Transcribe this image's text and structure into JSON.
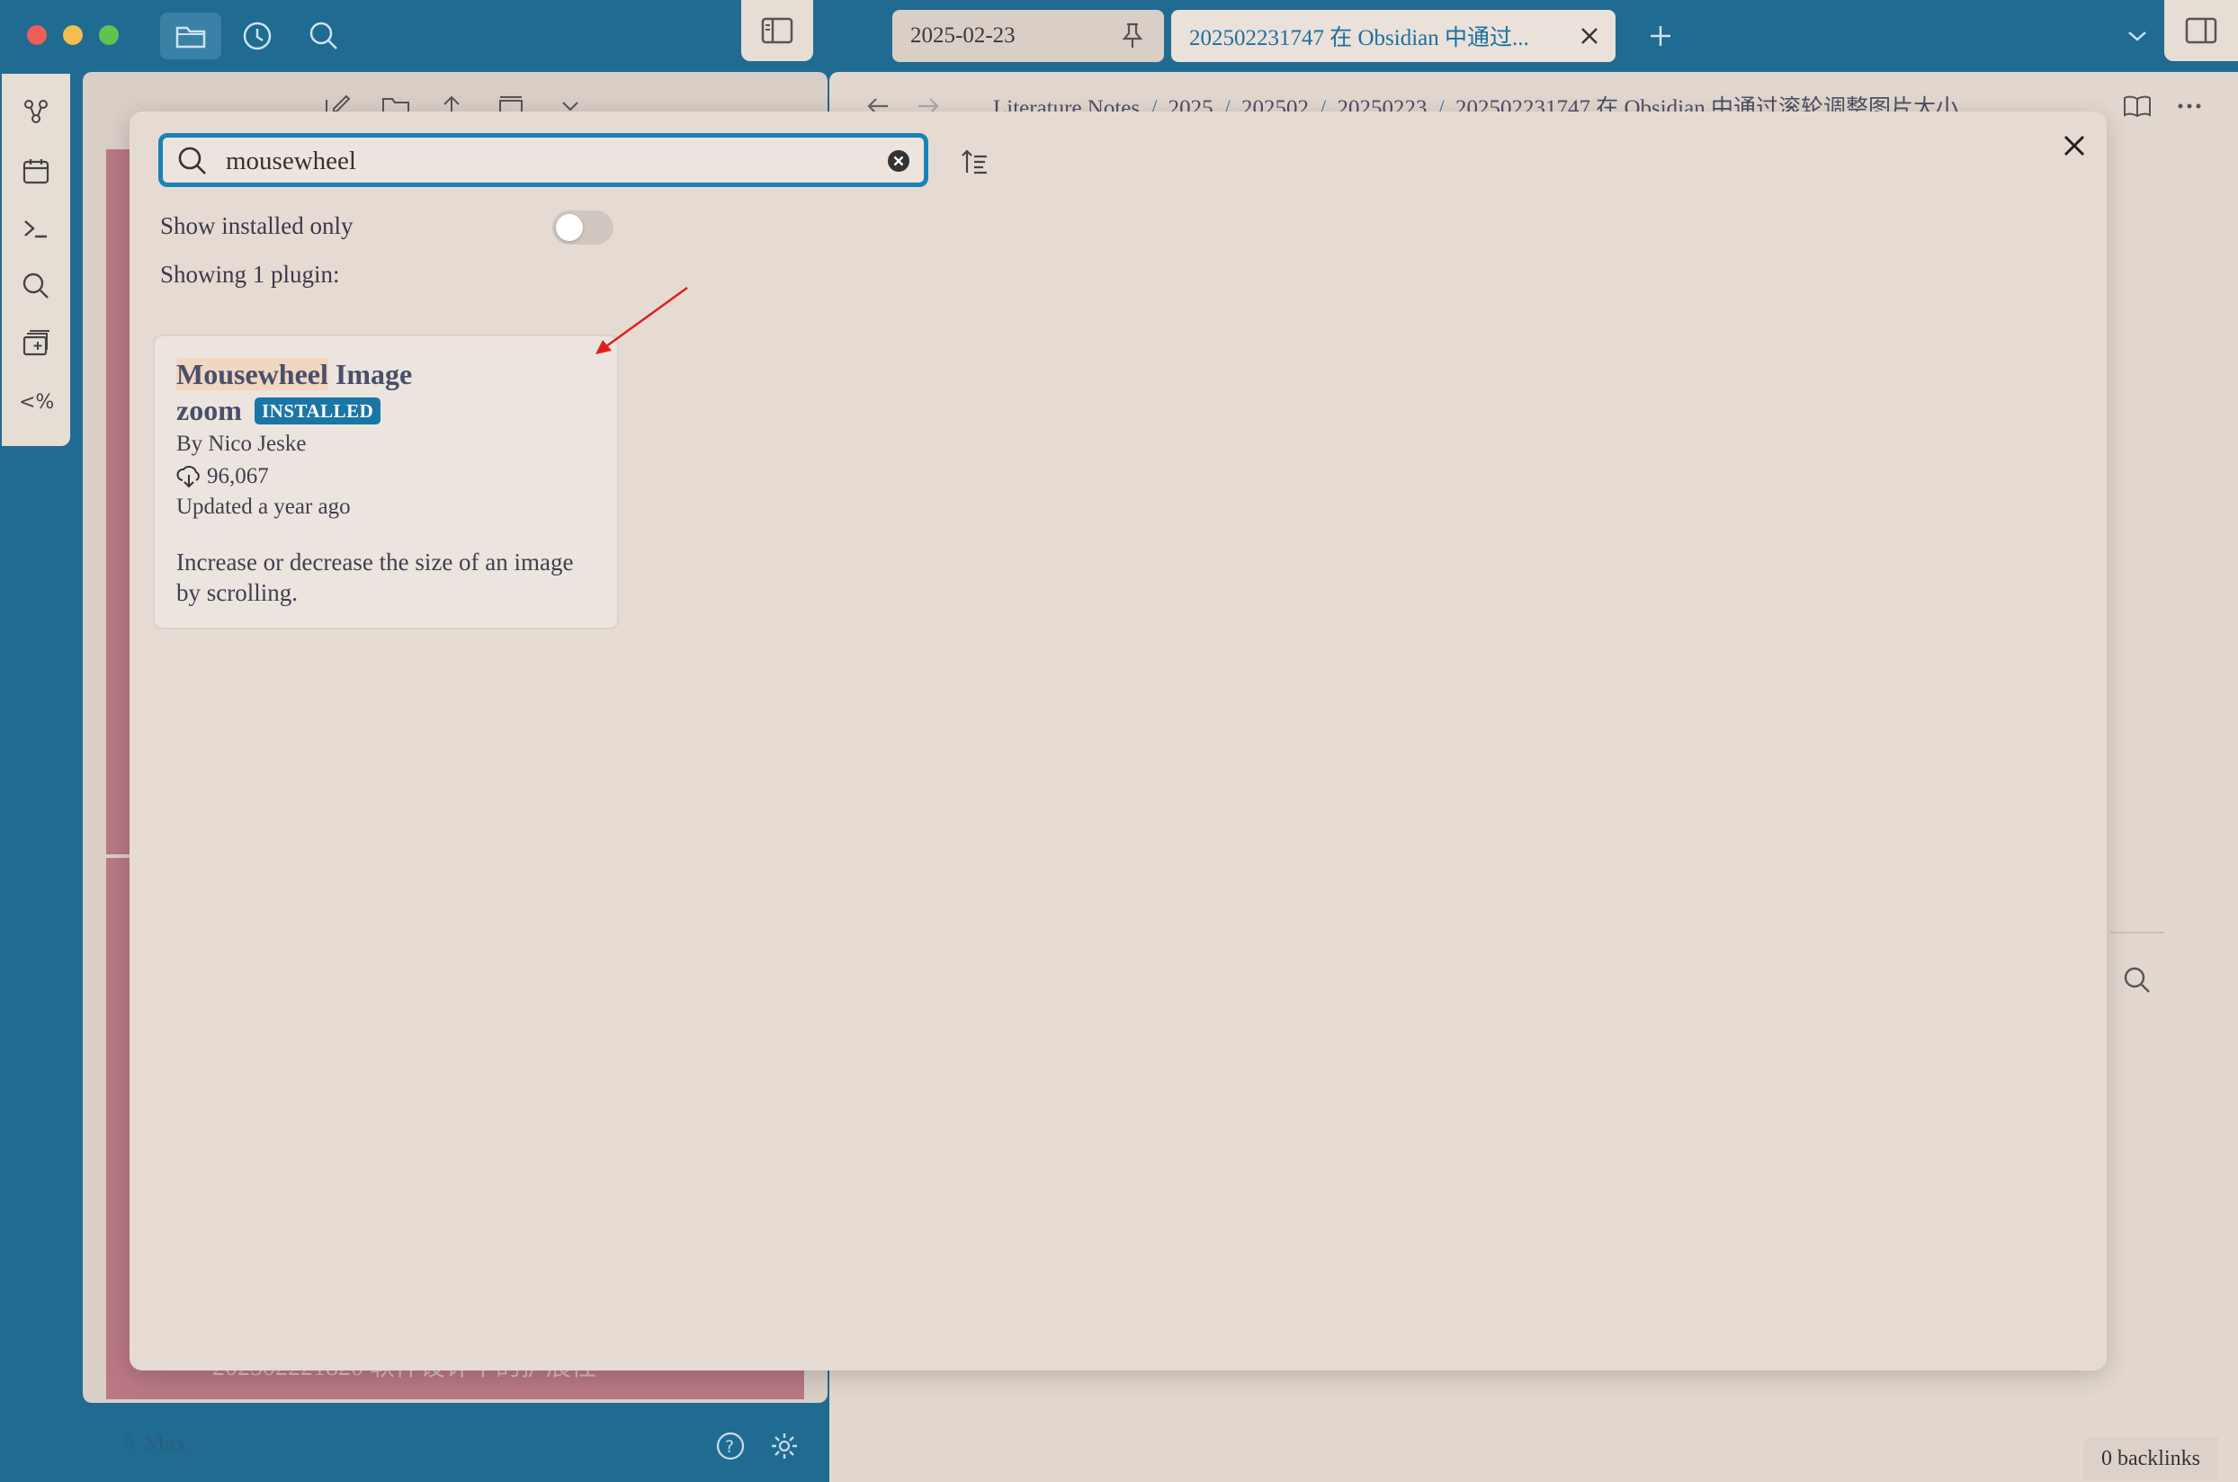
{
  "tabs": [
    {
      "label": "2025-02-23"
    },
    {
      "label": "202502231747 在 Obsidian 中通过..."
    }
  ],
  "breadcrumb": {
    "items": [
      "Literature Notes",
      "2025",
      "202502",
      "20250223",
      "202502231747 在 Obsidian 中通过滚轮调整图片大小"
    ],
    "separator": "/"
  },
  "modal": {
    "search_value": "mousewheel",
    "show_installed_label": "Show installed only",
    "show_installed_on": false,
    "count_label": "Showing 1 plugin:"
  },
  "plugin": {
    "name_highlight": "Mousewheel",
    "name_rest": " Image",
    "name_line2": "zoom",
    "badge": "INSTALLED",
    "author": "By Nico Jeske",
    "downloads": "96,067",
    "updated": "Updated a year ago",
    "description": "Increase or decrease the size of an image by scrolling."
  },
  "sidebar_bottom": {
    "vault_name": "Max",
    "hidden_file": "202502221820 软件设计中的扩展性"
  },
  "status": {
    "backlinks": "0 backlinks"
  },
  "colors": {
    "window_blue": "#1f6b92",
    "accent": "#1a82b6",
    "badge": "#1a76a6",
    "rose": "#b97884",
    "modal_bg": "#e5dbd2",
    "arrow": "#e02020"
  }
}
